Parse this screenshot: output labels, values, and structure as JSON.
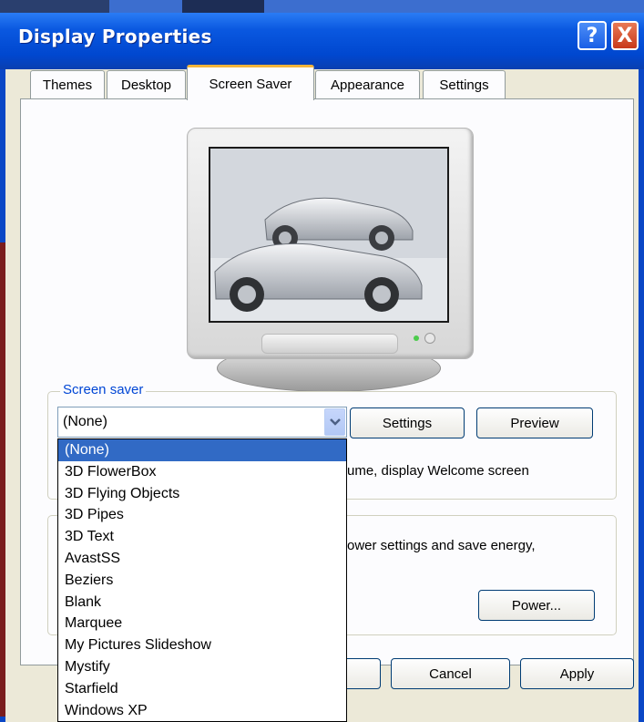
{
  "window": {
    "title": "Display Properties",
    "help_symbol": "?",
    "close_symbol": "X"
  },
  "tabs": [
    {
      "label": "Themes"
    },
    {
      "label": "Desktop"
    },
    {
      "label": "Screen Saver"
    },
    {
      "label": "Appearance"
    },
    {
      "label": "Settings"
    }
  ],
  "screen_saver": {
    "group_label": "Screen saver",
    "selected": "(None)",
    "settings_label": "Settings",
    "preview_label": "Preview",
    "resume_text_partial": "ume, display Welcome screen",
    "options": [
      "(None)",
      "3D FlowerBox",
      "3D Flying Objects",
      "3D Pipes",
      "3D Text",
      "AvastSS",
      "Beziers",
      "Blank",
      "Marquee",
      "My Pictures Slideshow",
      "Mystify",
      "Starfield",
      "Windows XP"
    ]
  },
  "power": {
    "text_partial": "ower settings and save energy,",
    "button_label": "Power..."
  },
  "footer": {
    "cancel_label": "Cancel",
    "apply_label": "Apply"
  }
}
